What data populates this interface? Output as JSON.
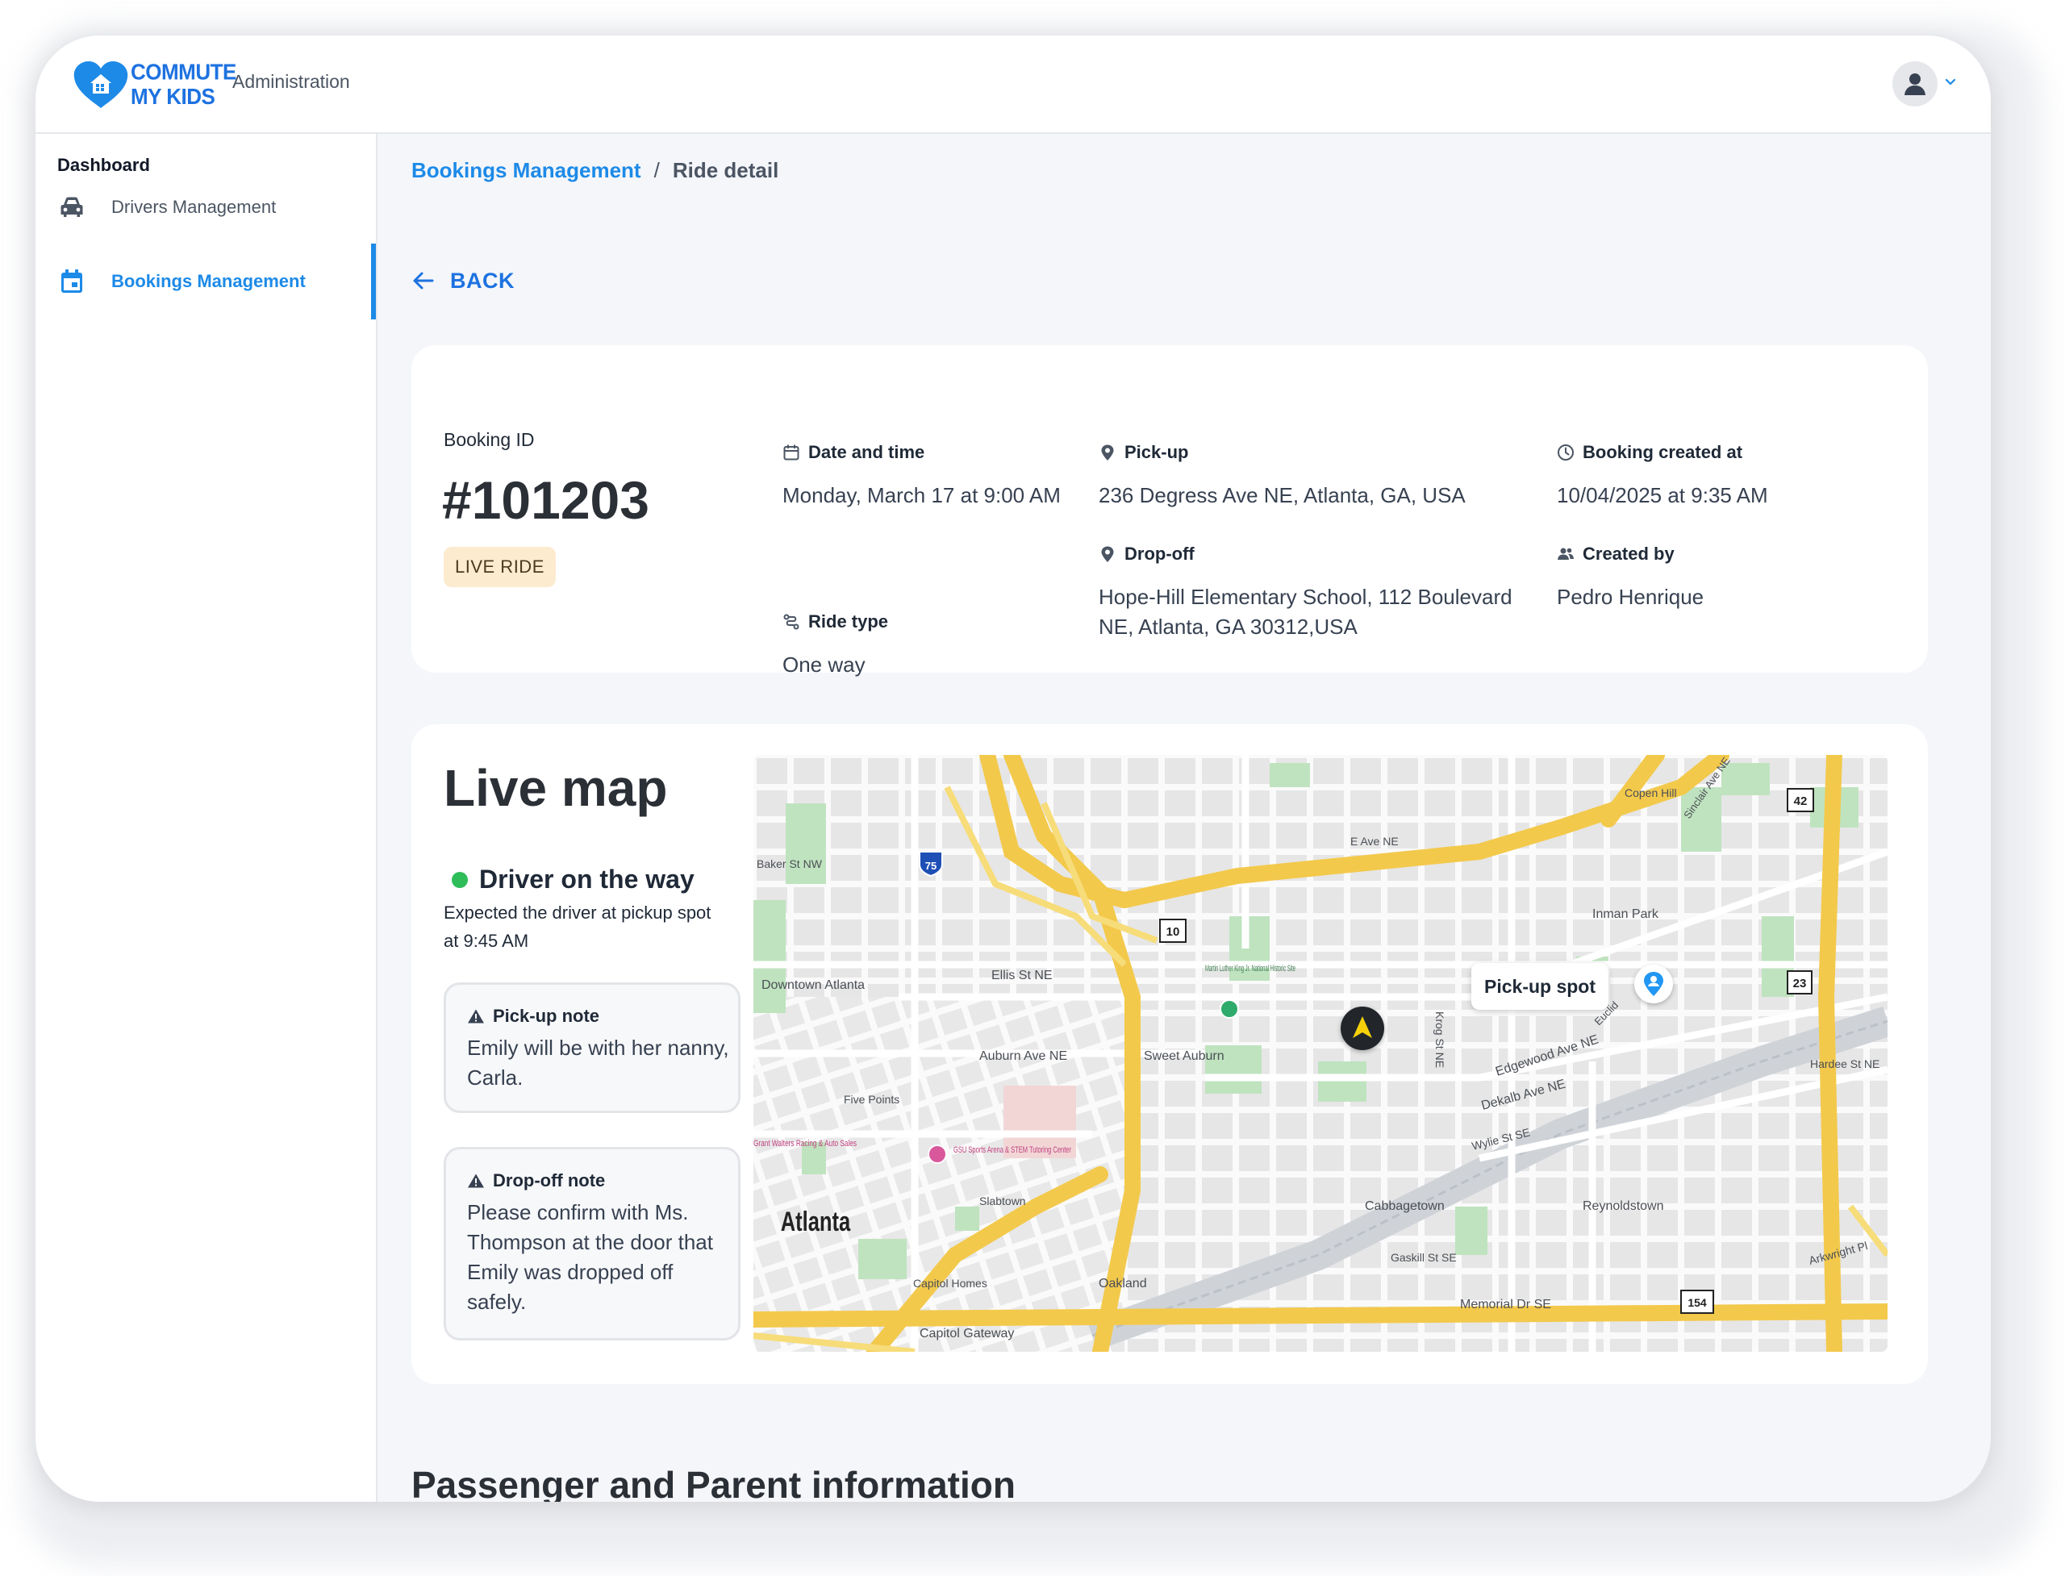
{
  "app": {
    "logo_text_line1": "COMMUTE",
    "logo_text_line2": "MY KIDS",
    "section": "Administration",
    "brand_color": "#1d72e0",
    "accent_color": "#1d8ae8"
  },
  "sidebar": {
    "title": "Dashboard",
    "items": [
      {
        "label": "Drivers Management",
        "icon": "car-icon",
        "active": false
      },
      {
        "label": "Bookings Management",
        "icon": "calendar-icon",
        "active": true
      }
    ]
  },
  "breadcrumb": {
    "parent": "Bookings Management",
    "separator": "/",
    "current": "Ride detail"
  },
  "back_label": "BACK",
  "booking": {
    "id_label": "Booking ID",
    "id": "#101203",
    "status_badge": "LIVE RIDE",
    "date_label": "Date and time",
    "date_value": "Monday, March 17 at 9:00 AM",
    "ride_type_label": "Ride type",
    "ride_type_value": "One way",
    "pickup_label": "Pick-up",
    "pickup_value": "236 Degress Ave NE, Atlanta, GA, USA",
    "dropoff_label": "Drop-off",
    "dropoff_value": "Hope-Hill Elementary School, 112 Boulevard NE, Atlanta, GA 30312,USA",
    "created_at_label": "Booking created at",
    "created_at_value": "10/04/2025 at 9:35 AM",
    "created_by_label": "Created by",
    "created_by_value": "Pedro Henrique"
  },
  "live_map": {
    "title": "Live map",
    "status": "Driver on the way",
    "status_color": "#2ebd59",
    "status_detail": "Expected the driver at pickup spot at 9:45 AM",
    "pickup_note_label": "Pick-up note",
    "pickup_note": "Emily will be with her nanny, Carla.",
    "dropoff_note_label": "Drop-off note",
    "dropoff_note": "Please confirm with Ms. Thompson at the door that Emily was dropped off safely.",
    "pin_label": "Pick-up spot",
    "map_labels": {
      "city": "Atlanta",
      "downtown": "Downtown Atlanta",
      "ellis": "Ellis St NE",
      "auburn": "Auburn Ave NE",
      "sweet_auburn": "Sweet Auburn",
      "five_points": "Five Points",
      "slabtown": "Slabtown",
      "capitol_homes": "Capitol Homes",
      "oakland": "Oakland",
      "capitol_gateway": "Capitol Gateway",
      "cabbagetown": "Cabbagetown",
      "reynoldstown": "Reynoldstown",
      "gaskill": "Gaskill St SE",
      "memorial": "Memorial Dr SE",
      "wylie": "Wylie St SE",
      "dekalb": "Dekalb Ave NE",
      "edgewood": "Edgewood Ave NE",
      "inman_park": "Inman Park",
      "copen_hill": "Copen Hill",
      "e_ave": "E Ave NE",
      "hardee": "Hardee St NE",
      "arkwright": "Arkwright Pl",
      "krog": "Krog St NE",
      "mlk": "Martin Luther King Jr. National Historic Site",
      "gsu": "GSU Sports Arena & STEM Tutoring Center",
      "grant_walters": "Grant Walters Racing & Auto Sales",
      "baker": "Baker St NW",
      "sinclair": "Sinclair Ave NE",
      "euclid": "Euclid",
      "shield_75": "75",
      "shield_10": "10",
      "shield_42": "42",
      "shield_23": "23",
      "shield_154": "154"
    }
  },
  "next_section_title": "Passenger and Parent information"
}
